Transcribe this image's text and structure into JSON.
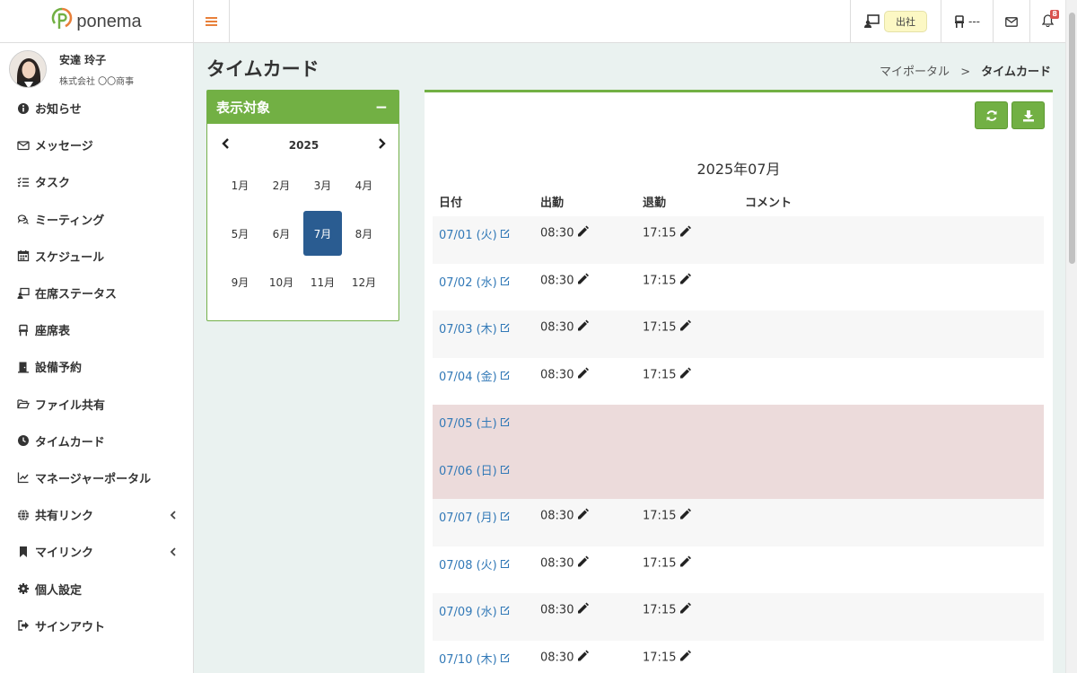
{
  "app": {
    "brand": "ponema"
  },
  "topbar": {
    "status_label": "出社",
    "seat_label": "---",
    "notification_count": "8"
  },
  "user": {
    "name": "安達 玲子",
    "company": "株式会社 〇〇商事"
  },
  "sidebar": {
    "items": [
      {
        "label": "お知らせ",
        "icon": "info-icon"
      },
      {
        "label": "メッセージ",
        "icon": "envelope-icon"
      },
      {
        "label": "タスク",
        "icon": "tasks-icon"
      },
      {
        "label": "ミーティング",
        "icon": "chat-bubbles-icon"
      },
      {
        "label": "スケジュール",
        "icon": "calendar-icon"
      },
      {
        "label": "在席ステータス",
        "icon": "presence-icon"
      },
      {
        "label": "座席表",
        "icon": "chair-icon"
      },
      {
        "label": "設備予約",
        "icon": "door-icon"
      },
      {
        "label": "ファイル共有",
        "icon": "folder-open-icon"
      },
      {
        "label": "タイムカード",
        "icon": "clock-icon"
      },
      {
        "label": "マネージャーポータル",
        "icon": "line-chart-icon"
      },
      {
        "label": "共有リンク",
        "icon": "globe-icon",
        "expandable": true
      },
      {
        "label": "マイリンク",
        "icon": "bookmark-icon",
        "expandable": true
      },
      {
        "label": "個人設定",
        "icon": "gear-icon"
      },
      {
        "label": "サインアウト",
        "icon": "sign-out-icon"
      }
    ]
  },
  "page": {
    "title": "タイムカード",
    "breadcrumb_parent": "マイポータル",
    "breadcrumb_sep": ">",
    "breadcrumb_current": "タイムカード"
  },
  "filter": {
    "title": "表示対象",
    "collapse_symbol": "−",
    "year": "2025",
    "months": [
      "1月",
      "2月",
      "3月",
      "4月",
      "5月",
      "6月",
      "7月",
      "8月",
      "9月",
      "10月",
      "11月",
      "12月"
    ],
    "selected_month": "7月"
  },
  "timecard": {
    "month_title": "2025年07月",
    "columns": {
      "date": "日付",
      "clock_in": "出勤",
      "clock_out": "退勤",
      "comment": "コメント"
    },
    "rows": [
      {
        "date": "07/01 (火)",
        "in": "08:30",
        "out": "17:15",
        "holiday": false
      },
      {
        "date": "07/02 (水)",
        "in": "08:30",
        "out": "17:15",
        "holiday": false
      },
      {
        "date": "07/03 (木)",
        "in": "08:30",
        "out": "17:15",
        "holiday": false
      },
      {
        "date": "07/04 (金)",
        "in": "08:30",
        "out": "17:15",
        "holiday": false
      },
      {
        "date": "07/05 (土)",
        "in": "",
        "out": "",
        "holiday": true
      },
      {
        "date": "07/06 (日)",
        "in": "",
        "out": "",
        "holiday": true
      },
      {
        "date": "07/07 (月)",
        "in": "08:30",
        "out": "17:15",
        "holiday": false
      },
      {
        "date": "07/08 (火)",
        "in": "08:30",
        "out": "17:15",
        "holiday": false
      },
      {
        "date": "07/09 (水)",
        "in": "08:30",
        "out": "17:15",
        "holiday": false
      },
      {
        "date": "07/10 (木)",
        "in": "08:30",
        "out": "17:15",
        "holiday": false
      }
    ]
  },
  "colors": {
    "accent_green": "#72b044",
    "selected_blue": "#2a5c91",
    "link_blue": "#3279b7",
    "holiday_row": "#ecdbdb",
    "hamburger_orange": "#e8803a"
  }
}
